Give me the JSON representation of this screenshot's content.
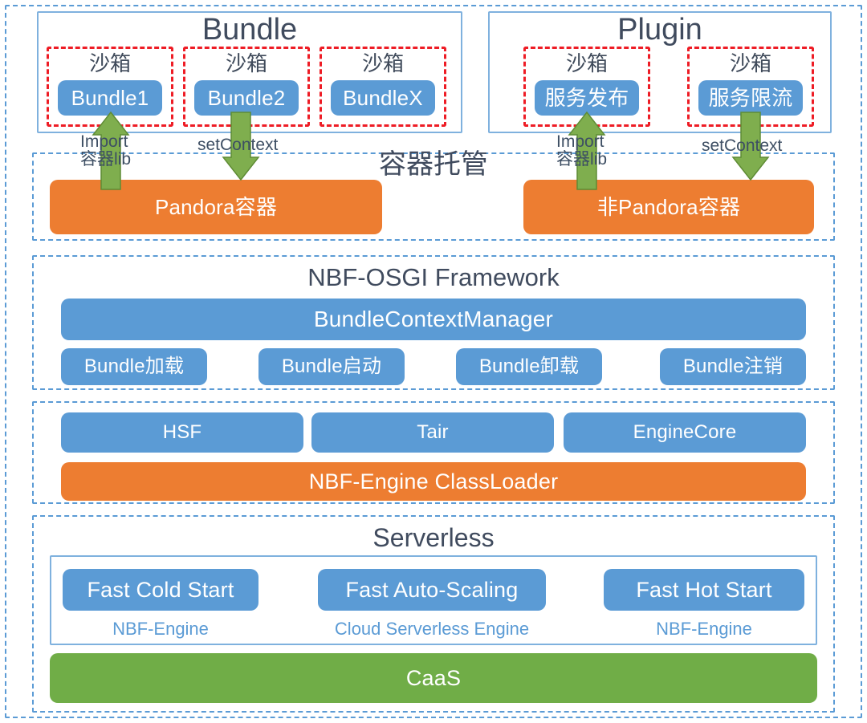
{
  "diagram": {
    "title_colors": {
      "heading": "#404B5E",
      "blue": "#5B9BD5",
      "orange": "#ED7D31",
      "green": "#70AD47",
      "red_dash": "#EE1C25",
      "arrow_green": "#7FAE4E"
    }
  },
  "bundle_group": {
    "title": "Bundle",
    "sandboxes": [
      {
        "label": "沙箱",
        "item": "Bundle1"
      },
      {
        "label": "沙箱",
        "item": "Bundle2"
      },
      {
        "label": "沙箱",
        "item": "BundleX"
      }
    ]
  },
  "plugin_group": {
    "title": "Plugin",
    "sandboxes": [
      {
        "label": "沙箱",
        "item": "服务发布"
      },
      {
        "label": "沙箱",
        "item": "服务限流"
      }
    ]
  },
  "container_layer": {
    "title": "容器托管",
    "arrows": [
      {
        "id": "import-left",
        "line1": "Import",
        "line2": "容器lib",
        "direction": "up"
      },
      {
        "id": "setcontext-left",
        "line1": "setContext",
        "line2": "",
        "direction": "down"
      },
      {
        "id": "import-right",
        "line1": "Import",
        "line2": "容器lib",
        "direction": "up"
      },
      {
        "id": "setcontext-right",
        "line1": "setContext",
        "line2": "",
        "direction": "down"
      }
    ],
    "containers": [
      {
        "label": "Pandora容器"
      },
      {
        "label": "非Pandora容器"
      }
    ]
  },
  "osgi_layer": {
    "title": "NBF-OSGI Framework",
    "manager": "BundleContextManager",
    "operations": [
      "Bundle加载",
      "Bundle启动",
      "Bundle卸载",
      "Bundle注销"
    ]
  },
  "engine_layer": {
    "components": [
      "HSF",
      "Tair",
      "EngineCore"
    ],
    "classloader": "NBF-Engine ClassLoader"
  },
  "serverless_layer": {
    "title": "Serverless",
    "stages": [
      {
        "name": "Fast Cold Start",
        "engine": "NBF-Engine"
      },
      {
        "name": "Fast Auto-Scaling",
        "engine": "Cloud Serverless Engine"
      },
      {
        "name": "Fast Hot Start",
        "engine": "NBF-Engine"
      }
    ],
    "platform": "CaaS"
  }
}
